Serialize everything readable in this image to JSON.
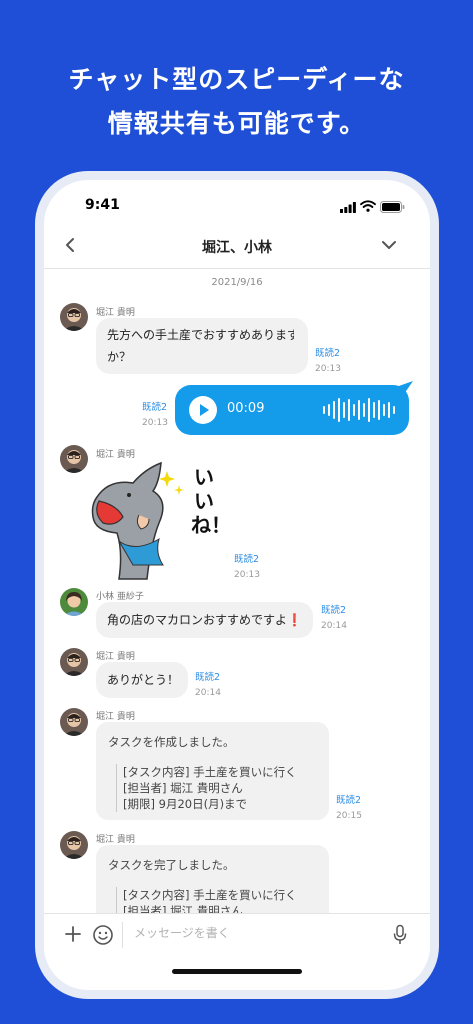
{
  "headline": {
    "line1": "チャット型のスピーディーな",
    "line2": "情報共有も可能です。"
  },
  "statusbar": {
    "time": "9:41"
  },
  "navbar": {
    "title": "堀江、小林"
  },
  "chat": {
    "date": "2021/9/16",
    "messages": [
      {
        "sender": "堀江 貴明",
        "text_line1": "先方への手土産でおすすめありますか",
        "text_line2": "か？",
        "read": "既読2",
        "time": "20:13"
      },
      {
        "type": "voice",
        "duration": "00:09",
        "read": "既読2",
        "time": "20:13"
      },
      {
        "sender": "堀江 貴明",
        "sticker_text": "いいね！",
        "read": "既読2",
        "time": "20:13"
      },
      {
        "sender": "小林 亜紗子",
        "text": "角の店のマカロンおすすめですよ",
        "emoji": "❗",
        "read": "既読2",
        "time": "20:14"
      },
      {
        "sender": "堀江 貴明",
        "text": "ありがとう！",
        "read": "既読2",
        "time": "20:14"
      },
      {
        "sender": "堀江 貴明",
        "heading": "タスクを作成しました。",
        "line1": "[タスク内容] 手土産を買いに行く",
        "line2": "[担当者] 堀江 貴明さん",
        "line3": "[期限] 9月20日(月)まで",
        "read": "既読2",
        "time": "20:15"
      },
      {
        "sender": "堀江 貴明",
        "heading": "タスクを完了しました。",
        "line1": "[タスク内容] 手土産を買いに行く",
        "line2": "[担当者] 堀江 貴明さん"
      }
    ]
  },
  "input": {
    "placeholder": "メッセージを書く"
  },
  "colors": {
    "background": "#1f4fd6",
    "voice_bubble": "#149be9",
    "read_label": "#2f8ee5"
  },
  "icons": [
    "back-chevron-icon",
    "dropdown-chevron-icon",
    "signal-icon",
    "wifi-icon",
    "battery-icon",
    "play-icon",
    "waveform-icon",
    "plus-icon",
    "emoji-icon",
    "microphone-icon"
  ]
}
